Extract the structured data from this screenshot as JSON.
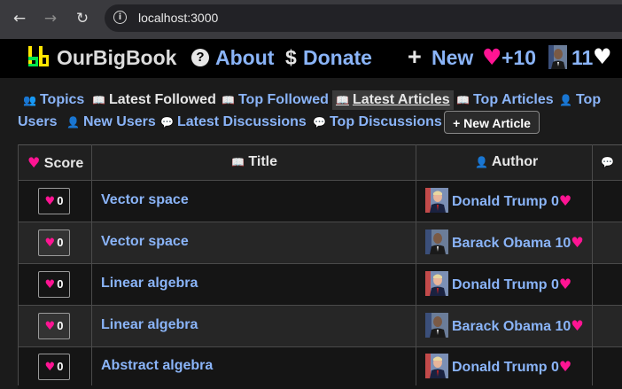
{
  "browser": {
    "url": "localhost:3000"
  },
  "header": {
    "brand": "OurBigBook",
    "about": "About",
    "donate_symbol": "$",
    "donate": "Donate",
    "new": "New",
    "score": "+10",
    "user_score": "11"
  },
  "tabs": [
    {
      "label": "Topics",
      "icon": "users-icon"
    },
    {
      "label": "Latest Followed",
      "icon": "book-icon"
    },
    {
      "label": "Top Followed",
      "icon": "book-icon"
    },
    {
      "label": "Latest Articles",
      "icon": "book-icon"
    },
    {
      "label": "Top Articles",
      "icon": "book-icon"
    },
    {
      "label": "Top Users",
      "icon": "user-icon"
    },
    {
      "label": "New Users",
      "icon": "user-icon"
    },
    {
      "label": "Latest Discussions",
      "icon": "chat-icon"
    },
    {
      "label": "Top Discussions",
      "icon": "chat-icon"
    }
  ],
  "new_article_button": "New Article",
  "table": {
    "headers": {
      "score": "Score",
      "title": "Title",
      "author": "Author"
    },
    "rows": [
      {
        "score": "0",
        "title": "Vector space",
        "author": "Donald Trump 0"
      },
      {
        "score": "0",
        "title": "Vector space",
        "author": "Barack Obama 10"
      },
      {
        "score": "0",
        "title": "Linear algebra",
        "author": "Donald Trump 0"
      },
      {
        "score": "0",
        "title": "Linear algebra",
        "author": "Barack Obama 10"
      },
      {
        "score": "0",
        "title": "Abstract algebra",
        "author": "Donald Trump 0"
      }
    ]
  },
  "colors": {
    "link": "#8ab4f8",
    "heart": "#ff1493",
    "background": "#1b1b1b"
  }
}
